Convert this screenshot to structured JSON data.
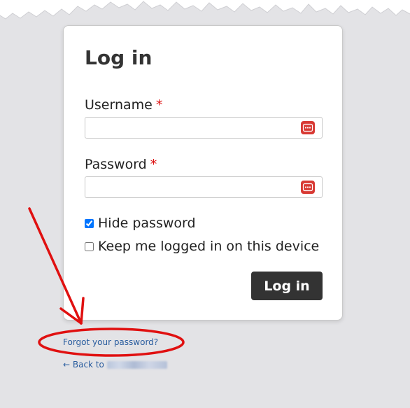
{
  "login": {
    "title": "Log in",
    "username_label": "Username",
    "password_label": "Password",
    "required_marker": "*",
    "username_value": "",
    "password_value": "",
    "hide_password_label": "Hide password",
    "hide_password_checked": true,
    "keep_logged_in_label": "Keep me logged in on this device",
    "keep_logged_in_checked": false,
    "submit_label": "Log in"
  },
  "links": {
    "forgot_password": "Forgot your password?",
    "back_prefix": "← Back to"
  },
  "icons": {
    "password_manager": "password-manager-icon"
  },
  "colors": {
    "background": "#e3e3e6",
    "button": "#333333",
    "link": "#2a5d9f",
    "required": "#dd1111",
    "annotation": "#e01010",
    "password_icon": "#d83a34"
  }
}
